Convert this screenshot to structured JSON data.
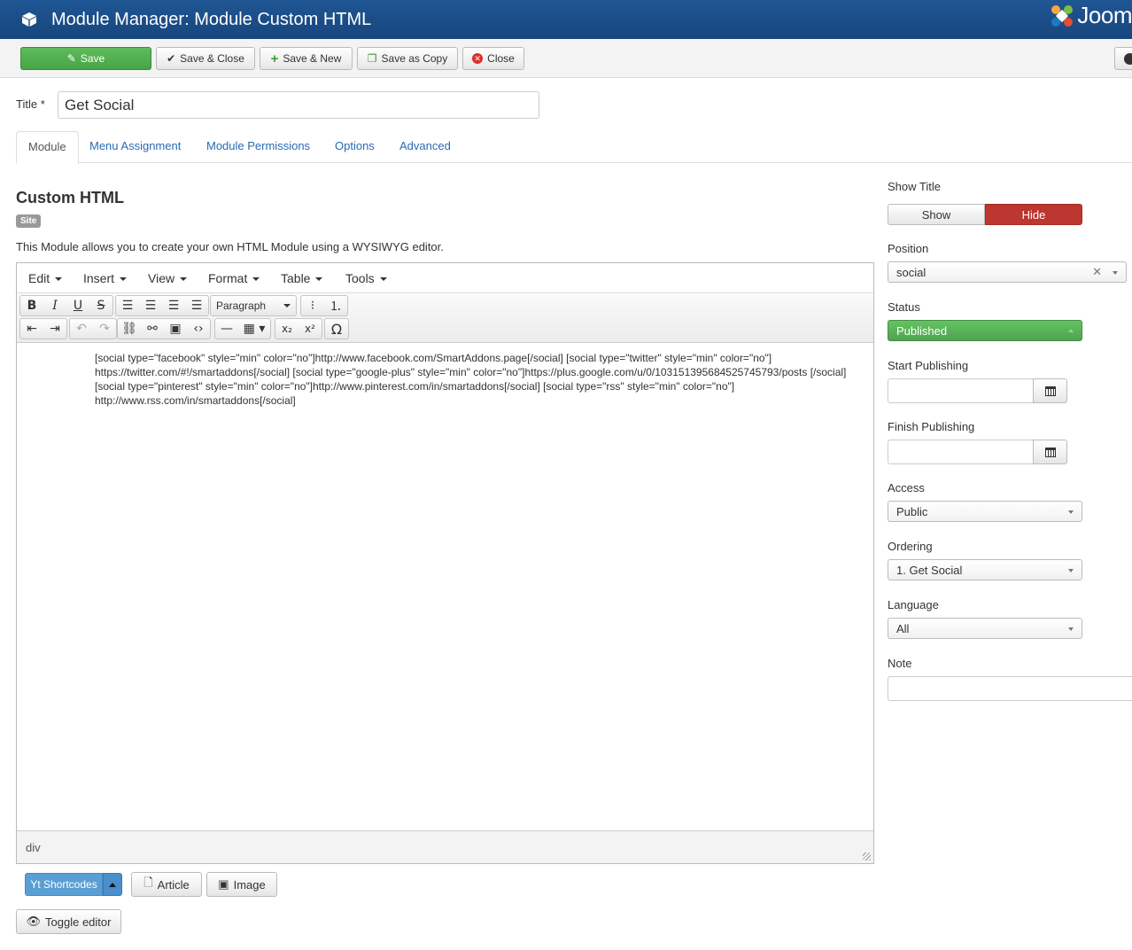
{
  "header": {
    "title": "Module Manager: Module Custom HTML",
    "brand": "Joom"
  },
  "toolbar": {
    "save": "Save",
    "save_close": "Save & Close",
    "save_new": "Save & New",
    "save_copy": "Save as Copy",
    "close": "Close"
  },
  "form": {
    "title_label": "Title *",
    "title_value": "Get Social"
  },
  "tabs": [
    "Module",
    "Menu Assignment",
    "Module Permissions",
    "Options",
    "Advanced"
  ],
  "main": {
    "heading": "Custom HTML",
    "badge": "Site",
    "description": "This Module allows you to create your own HTML Module using a WYSIWYG editor."
  },
  "editor": {
    "menus": [
      "Edit",
      "Insert",
      "View",
      "Format",
      "Table",
      "Tools"
    ],
    "block_format": "Paragraph",
    "content": "[social type=\"facebook\" style=\"min\" color=\"no\"]http://www.facebook.com/SmartAddons.page[/social] [social type=\"twitter\" style=\"min\" color=\"no\"] https://twitter.com/#!/smartaddons[/social] [social type=\"google-plus\" style=\"min\" color=\"no\"]https://plus.google.com/u/0/103151395684525745793/posts [/social] [social type=\"pinterest\" style=\"min\" color=\"no\"]http://www.pinterest.com/in/smartaddons[/social] [social type=\"rss\" style=\"min\" color=\"no\"] http://www.rss.com/in/smartaddons[/social]",
    "path": "div"
  },
  "editor_buttons": {
    "yt_shortcodes": "Yt Shortcodes",
    "article": "Article",
    "image": "Image",
    "toggle_editor": "Toggle editor"
  },
  "sidebar": {
    "show_title_label": "Show Title",
    "show": "Show",
    "hide": "Hide",
    "position_label": "Position",
    "position_value": "social",
    "status_label": "Status",
    "status_value": "Published",
    "start_publishing_label": "Start Publishing",
    "finish_publishing_label": "Finish Publishing",
    "access_label": "Access",
    "access_value": "Public",
    "ordering_label": "Ordering",
    "ordering_value": "1. Get Social",
    "language_label": "Language",
    "language_value": "All",
    "note_label": "Note"
  },
  "colors": {
    "header_bg": "#1a4d88",
    "save_green": "#46a546",
    "hide_red": "#bd362f",
    "published_green": "#51a351",
    "link_blue": "#2a6ab3",
    "shortcode_blue": "#5a9fd4"
  }
}
